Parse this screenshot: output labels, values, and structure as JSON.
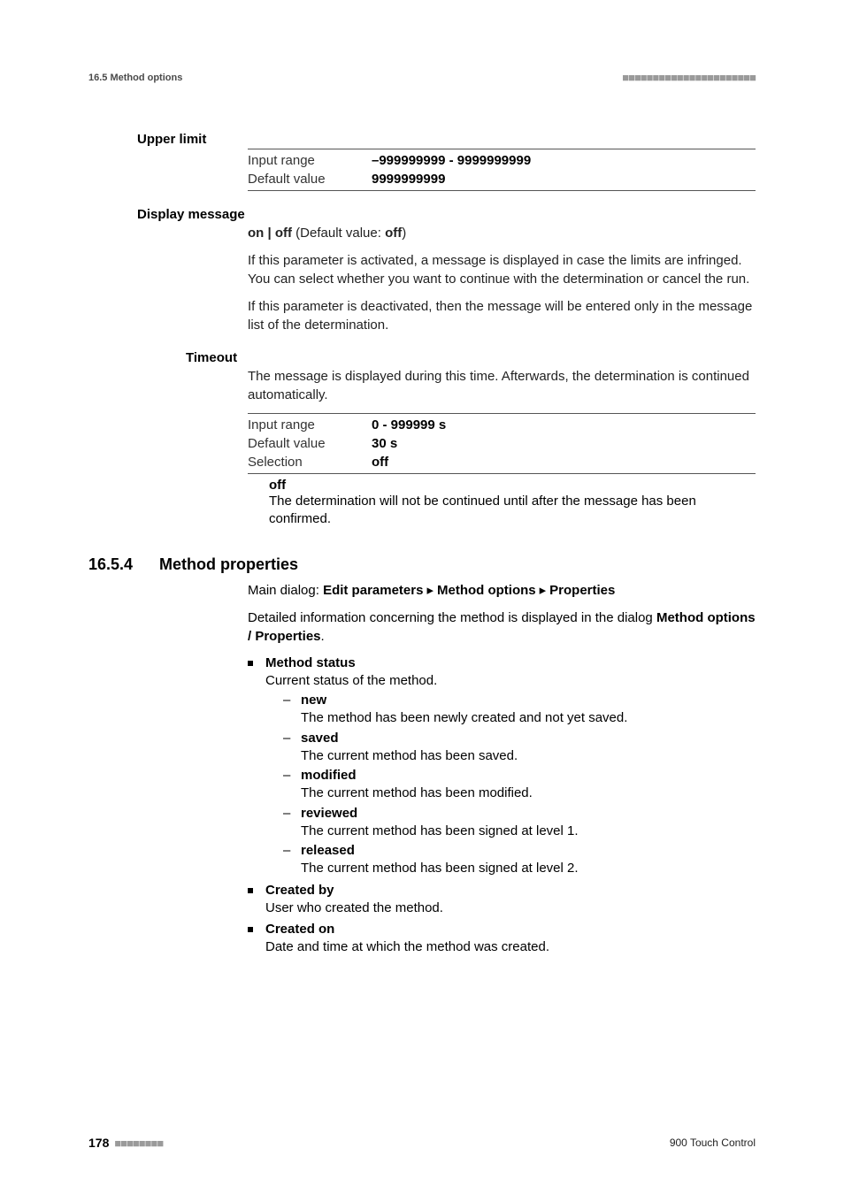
{
  "header": {
    "left": "16.5 Method options",
    "dots": "■■■■■■■■■■■■■■■■■■■■■■"
  },
  "upper_limit": {
    "term": "Upper limit",
    "rows": [
      {
        "label": "Input range",
        "value": "–999999999 - 9999999999"
      },
      {
        "label": "Default value",
        "value": "9999999999"
      }
    ]
  },
  "display_message": {
    "term": "Display message",
    "onoff_prefix": "on | off",
    "default_label": " (Default value: ",
    "default_value": "off",
    "default_close": ")",
    "para1": "If this parameter is activated, a message is displayed in case the limits are infringed. You can select whether you want to continue with the determination or cancel the run.",
    "para2": "If this parameter is deactivated, then the message will be entered only in the message list of the determination."
  },
  "timeout": {
    "term": "Timeout",
    "intro": "The message is displayed during this time. Afterwards, the determination is continued automatically.",
    "rows": [
      {
        "label": "Input range",
        "value": "0 - 999999 s"
      },
      {
        "label": "Default value",
        "value": "30 s"
      },
      {
        "label": "Selection",
        "value": "off"
      }
    ],
    "off_title": "off",
    "off_desc": "The determination will not be continued until after the message has been confirmed."
  },
  "section": {
    "num": "16.5.4",
    "title": "Method properties",
    "maindlg_label": "Main dialog: ",
    "maindlg_path": [
      "Edit parameters",
      "Method options",
      "Properties"
    ],
    "intro_a": "Detailed information concerning the method is displayed in the dialog ",
    "intro_b": "Method options / Properties",
    "intro_c": ".",
    "items": [
      {
        "title": "Method status",
        "desc": "Current status of the method.",
        "subs": [
          {
            "t": "new",
            "d": "The method has been newly created and not yet saved."
          },
          {
            "t": "saved",
            "d": "The current method has been saved."
          },
          {
            "t": "modified",
            "d": "The current method has been modified."
          },
          {
            "t": "reviewed",
            "d": "The current method has been signed at level 1."
          },
          {
            "t": "released",
            "d": "The current method has been signed at level 2."
          }
        ]
      },
      {
        "title": "Created by",
        "desc": "User who created the method."
      },
      {
        "title": "Created on",
        "desc": "Date and time at which the method was created."
      }
    ]
  },
  "footer": {
    "page": "178",
    "dots": "■■■■■■■■",
    "right": "900 Touch Control"
  }
}
